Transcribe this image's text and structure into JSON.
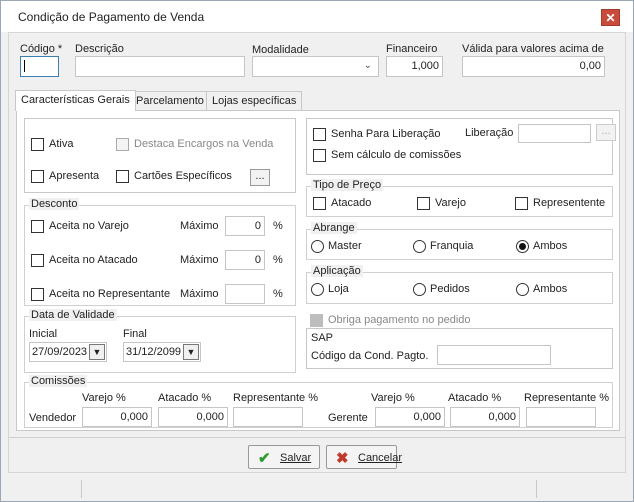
{
  "window": {
    "title": "Condição de Pagamento de Venda",
    "close_glyph": "✕"
  },
  "header": {
    "codigo_label": "Código *",
    "codigo_value": "",
    "descricao_label": "Descrição",
    "descricao_value": "",
    "modalidade_label": "Modalidade",
    "modalidade_value": "",
    "financeiro_label": "Financeiro",
    "financeiro_value": "1,000",
    "valida_label": "Válida para valores acima de",
    "valida_value": "0,00"
  },
  "tabs": [
    {
      "label": "Características Gerais",
      "active": true
    },
    {
      "label": "Parcelamento",
      "active": false
    },
    {
      "label": "Lojas específicas",
      "active": false
    }
  ],
  "general": {
    "ativa": {
      "label": "Ativa",
      "checked": false
    },
    "destaca": {
      "label": "Destaca  Encargos na Venda",
      "checked": false,
      "disabled": true
    },
    "apresenta": {
      "label": "Apresenta",
      "checked": false
    },
    "cartoes": {
      "label": "Cartões Específicos",
      "checked": false
    },
    "dots": "..."
  },
  "desconto": {
    "title": "Desconto",
    "maximo_label": "Máximo",
    "pct": "%",
    "rows": [
      {
        "label": "Aceita no Varejo",
        "value": "0"
      },
      {
        "label": "Aceita no Atacado",
        "value": "0"
      },
      {
        "label": "Aceita no Representante",
        "value": ""
      }
    ]
  },
  "validade": {
    "title": "Data de Validade",
    "inicial_label": "Inicial",
    "inicial_value": "27/09/2023",
    "final_label": "Final",
    "final_value": "31/12/2099",
    "dropdown_glyph": "▼"
  },
  "liberacao": {
    "senha_label": "Senha Para Liberação",
    "semcalc_label": "Sem cálculo de comissões",
    "liberacao_label": "Liberação",
    "liberacao_value": "",
    "dots": "..."
  },
  "tipo_preco": {
    "title": "Tipo de Preço",
    "options": [
      "Atacado",
      "Varejo",
      "Representente"
    ]
  },
  "abrange": {
    "title": "Abrange",
    "options": [
      "Master",
      "Franquia",
      "Ambos"
    ],
    "selected": "Ambos"
  },
  "aplicacao": {
    "title": "Aplicação",
    "options": [
      "Loja",
      "Pedidos",
      "Ambos"
    ],
    "selected": null
  },
  "obriga": {
    "label": "Obriga pagamento no pedido",
    "disabled": true
  },
  "sap": {
    "title": "SAP",
    "codigo_label": "Código da Cond. Pagto.",
    "codigo_value": ""
  },
  "comissoes": {
    "title": "Comissões",
    "vendedor_label": "Vendedor",
    "gerente_label": "Gerente",
    "varejo_label": "Varejo %",
    "atacado_label": "Atacado %",
    "representante_label": "Representante %",
    "vendedor_varejo": "0,000",
    "vendedor_atacado": "0,000",
    "vendedor_representante": "",
    "gerente_varejo": "0,000",
    "gerente_atacado": "0,000",
    "gerente_representante": ""
  },
  "buttons": {
    "salvar": "Salvar",
    "cancelar": "Cancelar",
    "salvar_icon": "✔",
    "cancelar_icon": "✖"
  }
}
